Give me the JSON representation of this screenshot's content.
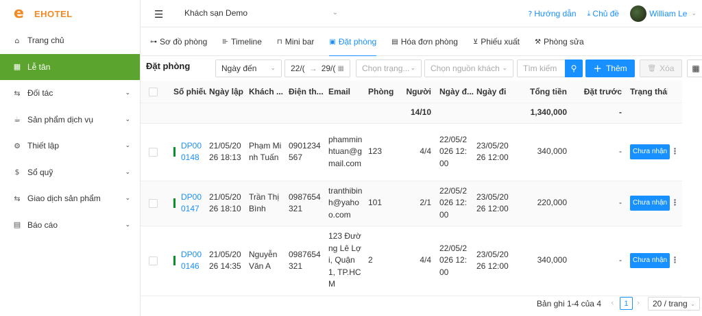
{
  "brand": {
    "logo_letter": "e",
    "name": "EHOTEL",
    "accent": "#f08a24"
  },
  "sidebar": {
    "items": [
      {
        "label": "Trang chủ",
        "icon": "home-icon",
        "glyph": "⌂",
        "has_chevron": false
      },
      {
        "label": "Lễ tân",
        "icon": "grid-icon",
        "glyph": "▦",
        "has_chevron": false
      },
      {
        "label": "Đối tác",
        "icon": "swap-icon",
        "glyph": "⇆",
        "has_chevron": true
      },
      {
        "label": "Sản phẩm dịch vụ",
        "icon": "cup-icon",
        "glyph": "☕",
        "has_chevron": true
      },
      {
        "label": "Thiết lập",
        "icon": "gear-icon",
        "glyph": "⚙",
        "has_chevron": true
      },
      {
        "label": "Sổ quỹ",
        "icon": "dollar-icon",
        "glyph": "$",
        "has_chevron": true
      },
      {
        "label": "Giao dịch sản phẩm",
        "icon": "swap-icon",
        "glyph": "⇆",
        "has_chevron": true
      },
      {
        "label": "Báo cáo",
        "icon": "report-icon",
        "glyph": "▤",
        "has_chevron": true
      }
    ],
    "active_index": 1,
    "active_color": "#5ba52e"
  },
  "header": {
    "hotel_select": "Khách sạn Demo",
    "help_label": "Hướng dẫn",
    "theme_label": "Chủ đề",
    "user_name": "William Le"
  },
  "tabs": [
    {
      "label": "Sơ đồ phòng",
      "icon": "network-icon",
      "glyph": "⊶"
    },
    {
      "label": "Timeline",
      "icon": "timeline-icon",
      "glyph": "⊪"
    },
    {
      "label": "Mini bar",
      "icon": "bag-icon",
      "glyph": "⊓"
    },
    {
      "label": "Đặt phòng",
      "icon": "calendar-icon",
      "glyph": "▣"
    },
    {
      "label": "Hóa đơn phòng",
      "icon": "invoice-icon",
      "glyph": "▤"
    },
    {
      "label": "Phiếu xuất",
      "icon": "cart-icon",
      "glyph": "⊻"
    },
    {
      "label": "Phòng sửa",
      "icon": "wrench-icon",
      "glyph": "⚒"
    }
  ],
  "active_tab": 3,
  "toolbar": {
    "title": "Đặt phòng",
    "date_type": "Ngày đến",
    "date_from": "22/(",
    "date_arrow": "→",
    "date_to": "29/(",
    "status_placeholder": "Chọn trạng...",
    "source_placeholder": "Chọn nguồn khách",
    "search_placeholder": "Tìm kiếm",
    "add_label": "Thêm",
    "delete_label": "Xóa"
  },
  "table": {
    "columns": [
      "Số phiếu",
      "Ngày lập",
      "Khách ...",
      "Điện th...",
      "Email",
      "Phòng",
      "Người",
      "Ngày đ...",
      "Ngày đi",
      "Tổng tiền",
      "Đặt trước",
      "Trạng thái"
    ],
    "summary": {
      "guests": "14/10",
      "total": "1,340,000",
      "deposit": "-"
    },
    "rows": [
      {
        "code": "DP000148",
        "created": "21/05/2026 18:13",
        "guest": "Phạm Minh Tuấn",
        "phone": "0901234567",
        "email": "phamminhtuan@gmail.com",
        "room": "123",
        "people": "4/4",
        "arrive": "22/05/2026 12:00",
        "depart": "23/05/2026 12:00",
        "total": "340,000",
        "deposit": "-",
        "status": "Chưa nhận"
      },
      {
        "code": "DP000147",
        "created": "21/05/2026 18:10",
        "guest": "Trần Thị Bình",
        "phone": "0987654321",
        "email": "tranthibinh@yahoo.com",
        "room": "101",
        "people": "2/1",
        "arrive": "22/05/2026 12:00",
        "depart": "23/05/2026 12:00",
        "total": "220,000",
        "deposit": "-",
        "status": "Chưa nhận"
      },
      {
        "code": "DP000146",
        "created": "21/05/2026 14:35",
        "guest": "Nguyễn Văn A",
        "phone": "0987654321",
        "email": "123 Đường Lê Lợi, Quận 1, TP.HCM",
        "room": "2",
        "people": "4/4",
        "arrive": "22/05/2026 12:00",
        "depart": "23/05/2026 12:00",
        "total": "340,000",
        "deposit": "-",
        "status": "Chưa nhận"
      }
    ]
  },
  "pagination": {
    "total_text": "Bản ghi 1-4 của 4",
    "current_page": "1",
    "page_size": "20 / trang"
  }
}
